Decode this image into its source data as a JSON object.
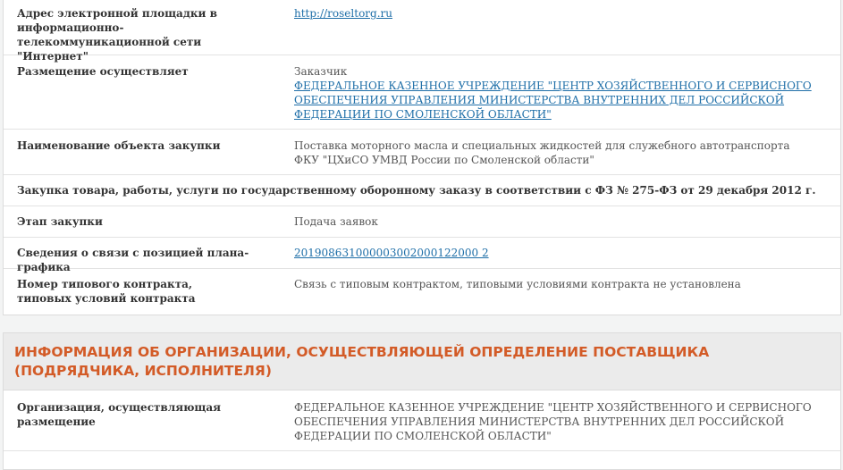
{
  "rows": {
    "address": {
      "label": "Адрес электронной площадки в информационно-телекоммуникационной сети \"Интернет\"",
      "value": "http://roseltorg.ru"
    },
    "placement": {
      "label": "Размещение осуществляет",
      "role": "Заказчик",
      "org": "ФЕДЕРАЛЬНОЕ КАЗЕННОЕ УЧРЕЖДЕНИЕ \"ЦЕНТР ХОЗЯЙСТВЕННОГО И СЕРВИСНОГО ОБЕСПЕЧЕНИЯ УПРАВЛЕНИЯ МИНИСТЕРСТВА ВНУТРЕННИХ ДЕЛ РОССИЙСКОЙ ФЕДЕРАЦИИ ПО СМОЛЕНСКОЙ ОБЛАСТИ\""
    },
    "object_name": {
      "label": "Наименование объекта закупки",
      "value": "Поставка моторного масла и специальных жидкостей для служебного автотранспорта ФКУ \"ЦХиСО УМВД России по Смоленской области\""
    },
    "defense_order": {
      "text": "Закупка товара, работы, услуги по государственному оборонному заказу в соответствии с ФЗ № 275-ФЗ от 29 декабря 2012 г."
    },
    "stage": {
      "label": "Этап закупки",
      "value": "Подача заявок"
    },
    "plan_position": {
      "label": "Сведения о связи с позицией плана-графика",
      "value": "201908631000003002000122000 2"
    },
    "contract": {
      "label": "Номер типового контракта, типовых условий контракта",
      "value": "Связь с типовым контрактом, типовыми условиями контракта не установлена"
    }
  },
  "section2": {
    "title": "Информация об организации, осуществляющей определение поставщика (подрядчика, исполнителя)",
    "org_row": {
      "label": "Организация, осуществляющая размещение",
      "value": "ФЕДЕРАЛЬНОЕ КАЗЕННОЕ УЧРЕЖДЕНИЕ \"ЦЕНТР ХОЗЯЙСТВЕННОГО И СЕРВИСНОГО ОБЕСПЕЧЕНИЯ УПРАВЛЕНИЯ МИНИСТЕРСТВА ВНУТРЕННИХ ДЕЛ РОССИЙСКОЙ ФЕДЕРАЦИИ ПО СМОЛЕНСКОЙ ОБЛАСТИ\""
    }
  },
  "colors": {
    "accent": "#d35b27",
    "link": "#1f6fa8"
  }
}
